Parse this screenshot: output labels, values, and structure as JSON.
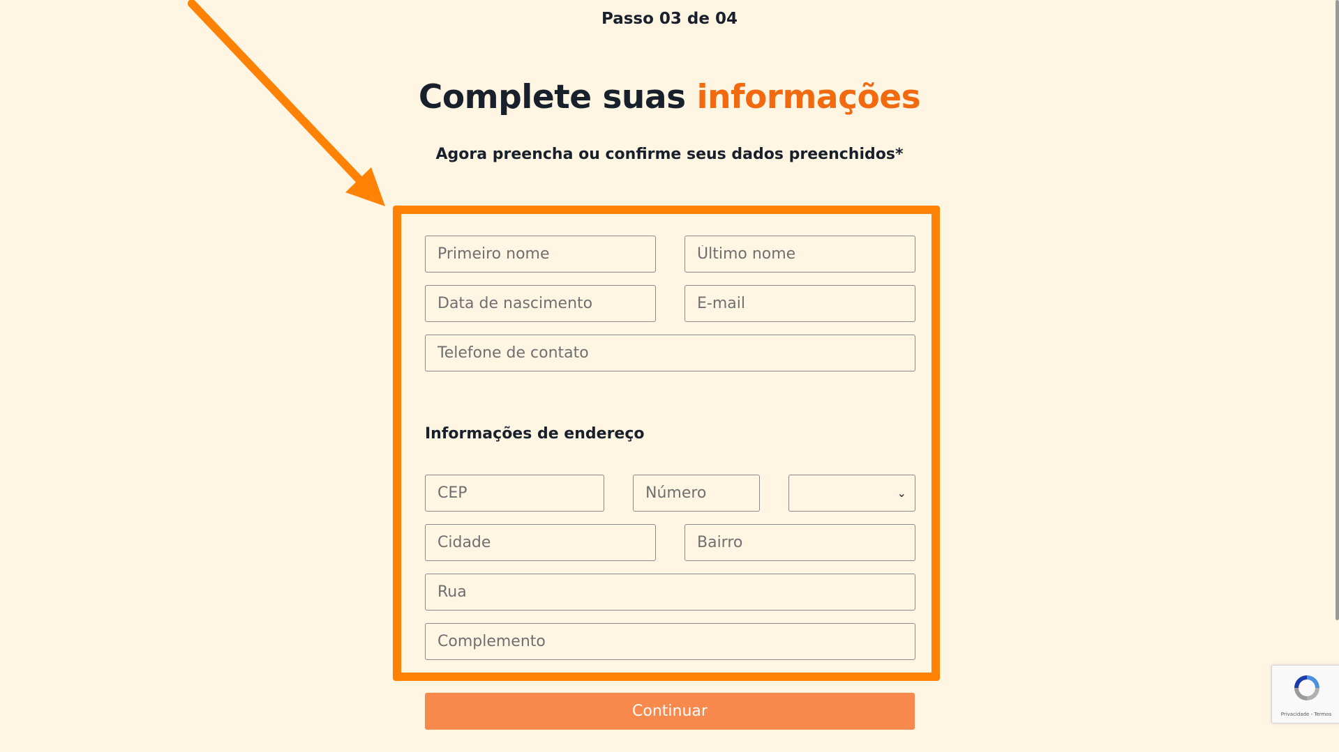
{
  "header": {
    "step": "Passo 03 de 04",
    "title_part1": "Complete suas ",
    "title_part2": "informações",
    "subtitle": "Agora preencha ou confirme seus dados preenchidos*"
  },
  "personal": {
    "first_name": "Primeiro nome",
    "last_name": "Último nome",
    "birth_date": "Data de nascimento",
    "email": "E-mail",
    "phone": "Telefone de contato"
  },
  "address": {
    "section_title": "Informações de endereço",
    "cep": "CEP",
    "number": "Número",
    "state_value": "",
    "city": "Cidade",
    "neighborhood": "Bairro",
    "street": "Rua",
    "complement": "Complemento"
  },
  "actions": {
    "continue_label": "Continuar"
  },
  "recaptcha": {
    "terms": "Privacidade - Termos"
  },
  "colors": {
    "background": "#fff5e3",
    "accent": "#f26a0f",
    "highlight": "#ff8205",
    "button": "#f7894d"
  }
}
